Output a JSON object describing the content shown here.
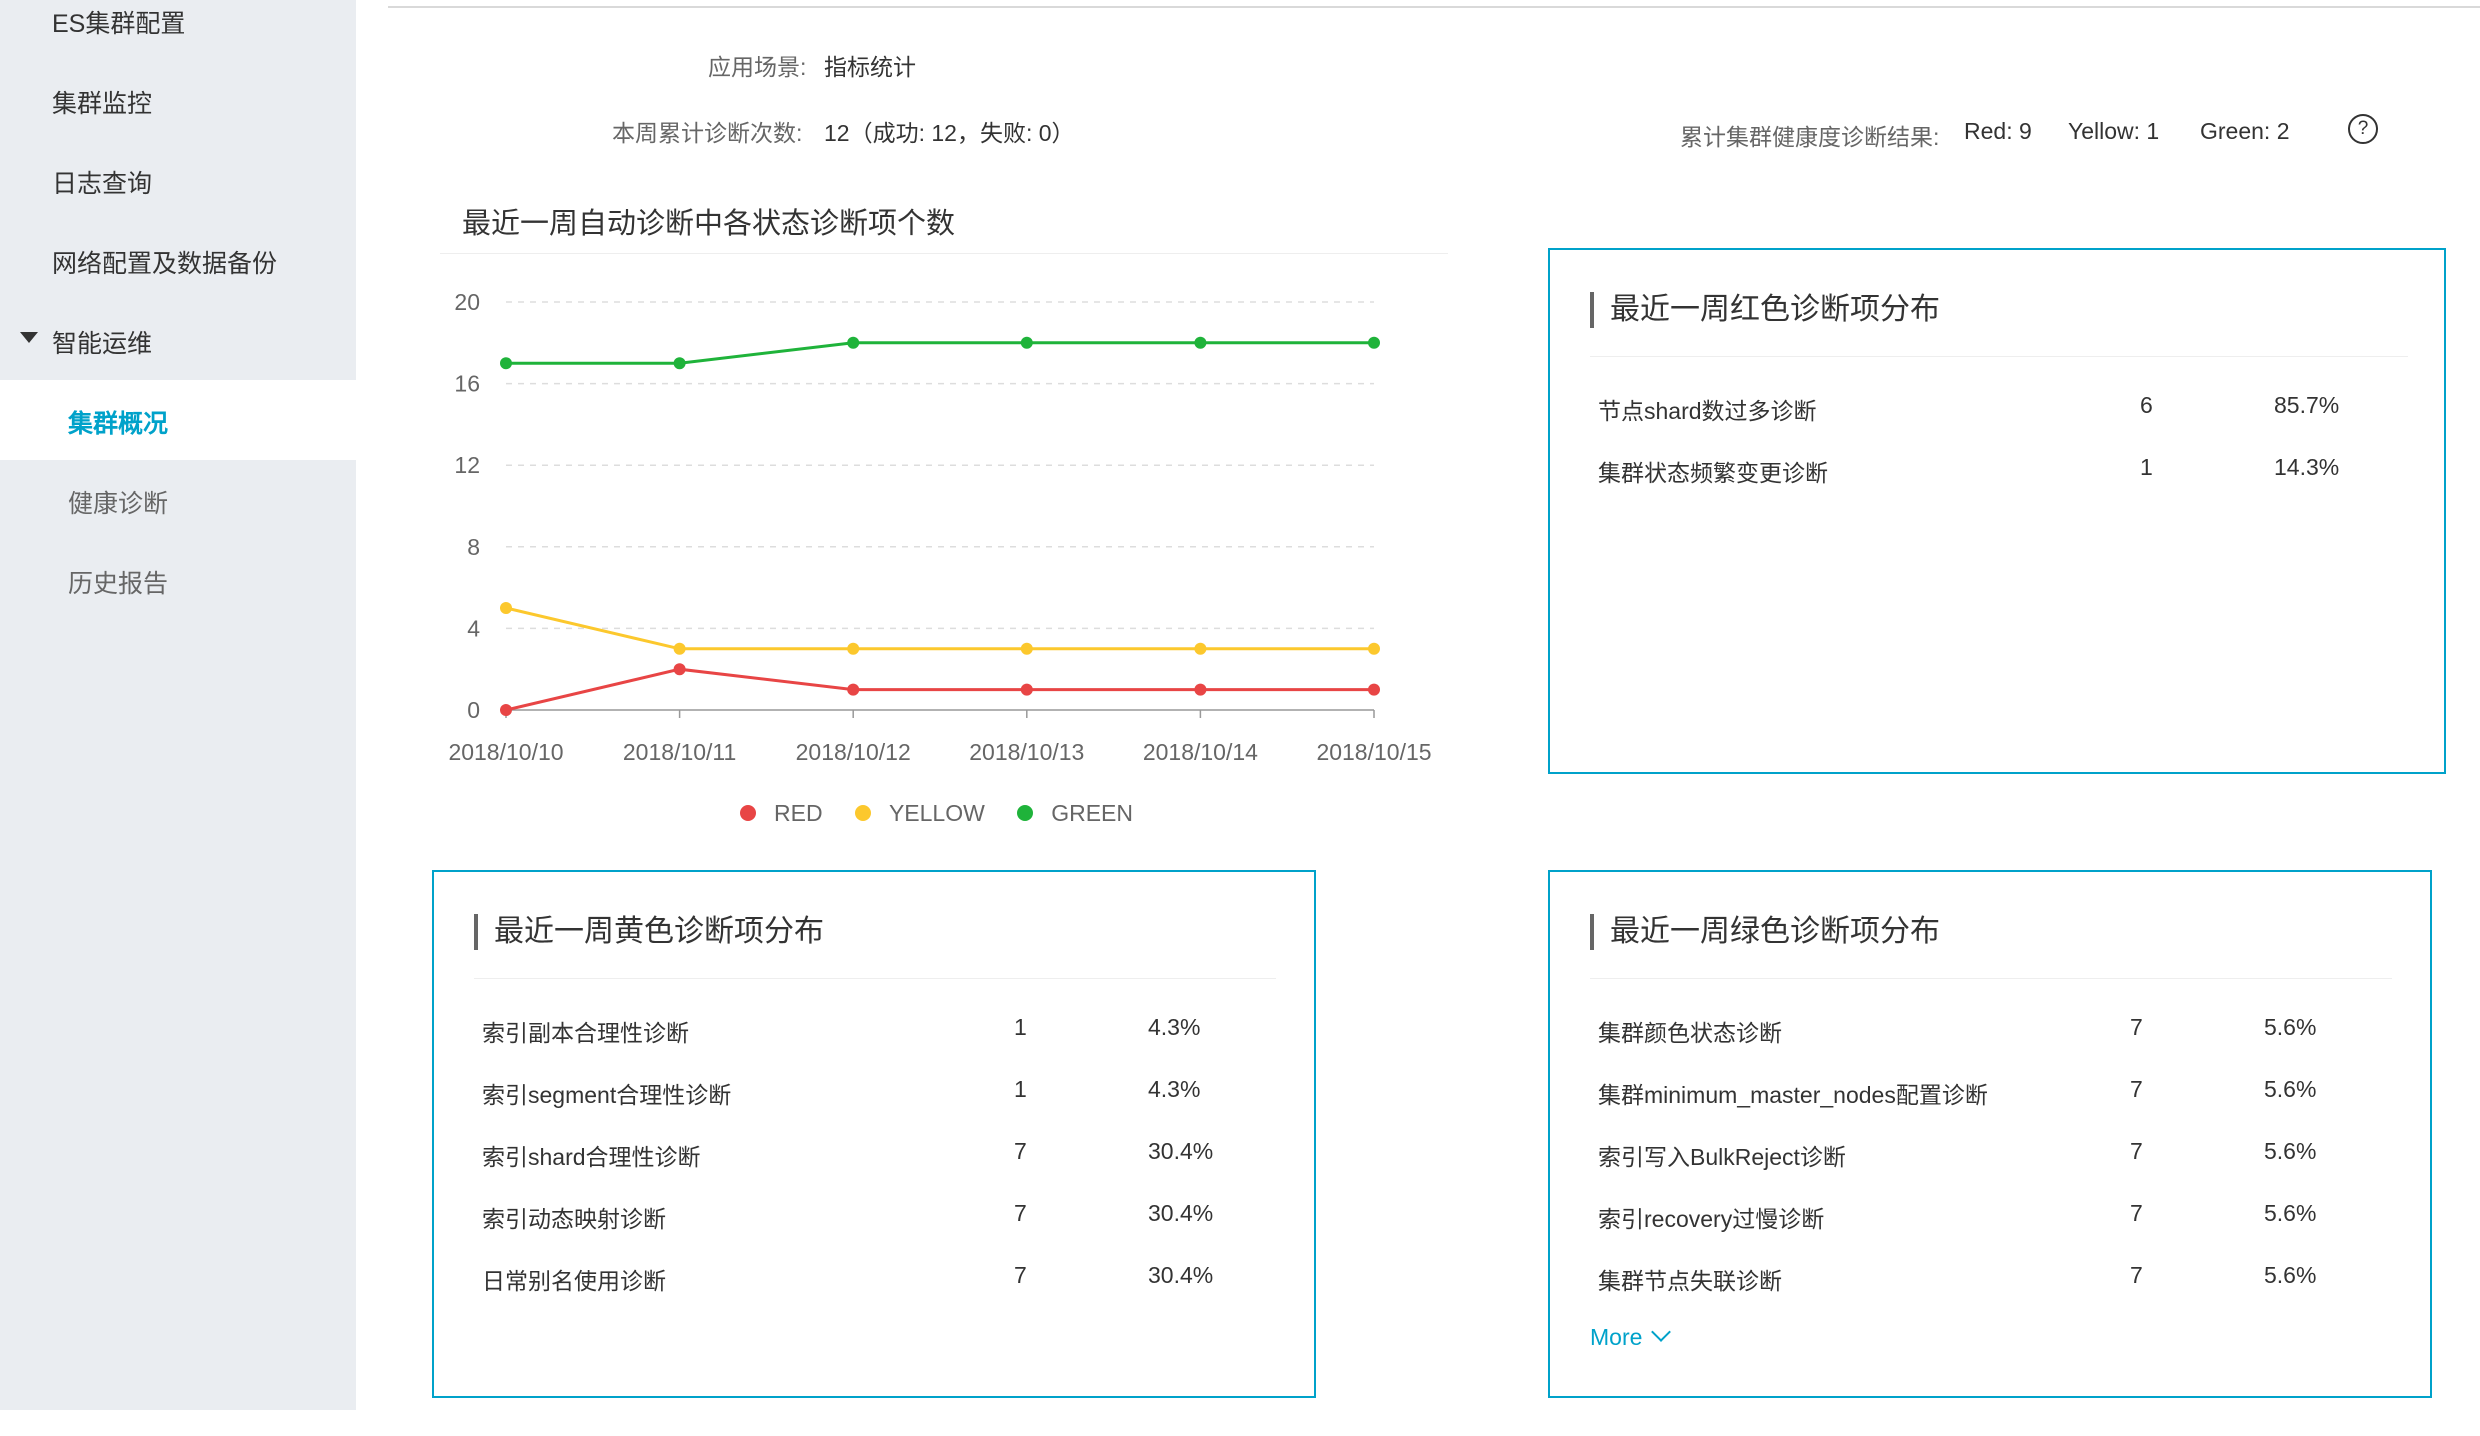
{
  "sidebar": {
    "items": [
      {
        "label": "ES集群配置"
      },
      {
        "label": "集群监控"
      },
      {
        "label": "日志查询"
      },
      {
        "label": "网络配置及数据备份"
      },
      {
        "label": "智能运维"
      }
    ],
    "sub_items": [
      {
        "label": "集群概况",
        "active": true
      },
      {
        "label": "健康诊断"
      },
      {
        "label": "历史报告"
      }
    ]
  },
  "info": {
    "scene_label": "应用场景:",
    "scene_value": "指标统计",
    "count_label": "本周累计诊断次数:",
    "count_value": "12（成功: 12，失败: 0）",
    "health_label": "累计集群健康度诊断结果:",
    "health_red": "Red: 9",
    "health_yellow": "Yellow: 1",
    "health_green": "Green: 2",
    "help_glyph": "?"
  },
  "chart_title": "最近一周自动诊断中各状态诊断项个数",
  "chart_data": {
    "type": "line",
    "title": "最近一周自动诊断中各状态诊断项个数",
    "categories": [
      "2018/10/10",
      "2018/10/11",
      "2018/10/12",
      "2018/10/13",
      "2018/10/14",
      "2018/10/15"
    ],
    "ylim": [
      0,
      20
    ],
    "yticks": [
      "0",
      "4",
      "8",
      "12",
      "16",
      "20"
    ],
    "grid": true,
    "legend_position": "bottom",
    "series": [
      {
        "name": "RED",
        "color": "#e84545",
        "values": [
          0,
          2,
          1,
          1,
          1,
          1
        ]
      },
      {
        "name": "YELLOW",
        "color": "#fcc82d",
        "values": [
          5,
          3,
          3,
          3,
          3,
          3
        ]
      },
      {
        "name": "GREEN",
        "color": "#1fb33a",
        "values": [
          17,
          17,
          18,
          18,
          18,
          18
        ]
      }
    ]
  },
  "red_panel": {
    "title": "最近一周红色诊断项分布",
    "rows": [
      {
        "name": "节点shard数过多诊断",
        "count": "6",
        "pct": "85.7%"
      },
      {
        "name": "集群状态频繁变更诊断",
        "count": "1",
        "pct": "14.3%"
      }
    ]
  },
  "yellow_panel": {
    "title": "最近一周黄色诊断项分布",
    "rows": [
      {
        "name": "索引副本合理性诊断",
        "count": "1",
        "pct": "4.3%"
      },
      {
        "name": "索引segment合理性诊断",
        "count": "1",
        "pct": "4.3%"
      },
      {
        "name": "索引shard合理性诊断",
        "count": "7",
        "pct": "30.4%"
      },
      {
        "name": "索引动态映射诊断",
        "count": "7",
        "pct": "30.4%"
      },
      {
        "name": "日常别名使用诊断",
        "count": "7",
        "pct": "30.4%"
      }
    ]
  },
  "green_panel": {
    "title": "最近一周绿色诊断项分布",
    "rows": [
      {
        "name": "集群颜色状态诊断",
        "count": "7",
        "pct": "5.6%"
      },
      {
        "name": "集群minimum_master_nodes配置诊断",
        "count": "7",
        "pct": "5.6%"
      },
      {
        "name": "索引写入BulkReject诊断",
        "count": "7",
        "pct": "5.6%"
      },
      {
        "name": "索引recovery过慢诊断",
        "count": "7",
        "pct": "5.6%"
      },
      {
        "name": "集群节点失联诊断",
        "count": "7",
        "pct": "5.6%"
      }
    ],
    "more_label": "More"
  }
}
